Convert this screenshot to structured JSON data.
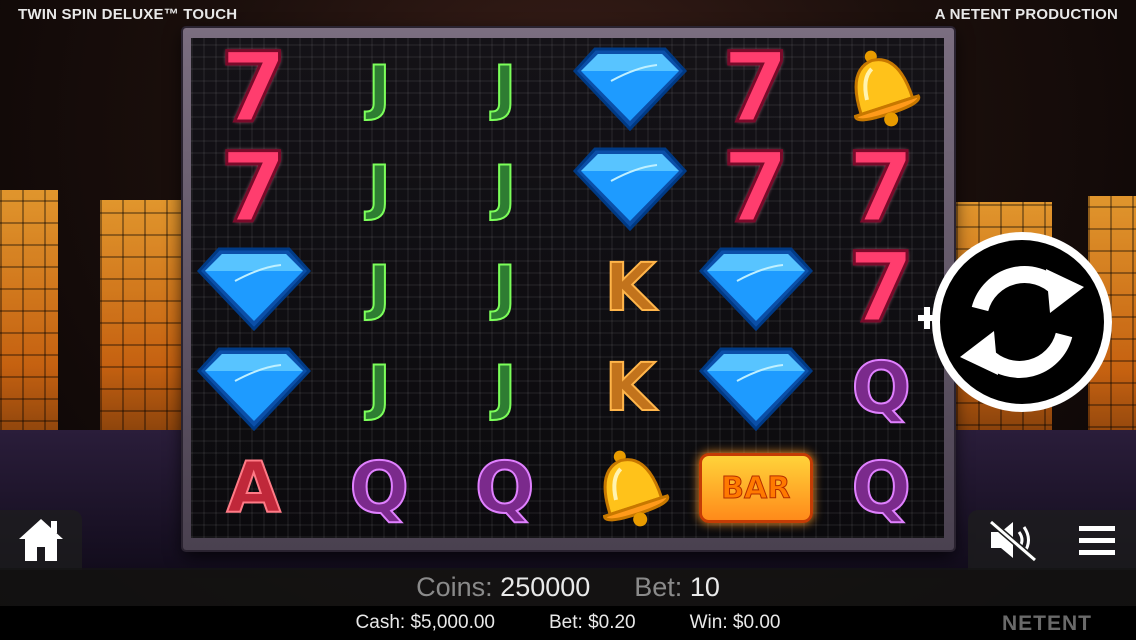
{
  "header": {
    "game_title": "TWIN SPIN DELUXE™ TOUCH",
    "producer": "A NETENT PRODUCTION"
  },
  "reels": [
    [
      "seven",
      "j",
      "j",
      "diamond",
      "seven",
      "bell"
    ],
    [
      "seven",
      "j",
      "j",
      "diamond",
      "seven",
      "seven"
    ],
    [
      "diamond",
      "j",
      "j",
      "k",
      "diamond",
      "seven"
    ],
    [
      "diamond",
      "j",
      "j",
      "k",
      "diamond",
      "q"
    ],
    [
      "a",
      "q",
      "q",
      "bell",
      "bar",
      "q"
    ]
  ],
  "symbol_text": {
    "j": "J",
    "k": "K",
    "q": "Q",
    "a": "A",
    "seven": "7",
    "bar": "BAR"
  },
  "icons": {
    "home": "home-icon",
    "sound": "sound-muted-icon",
    "menu": "menu-icon",
    "spin": "spin-refresh-icon",
    "plus": "plus-icon"
  },
  "info": {
    "coins_label": "Coins:",
    "coins_value": "250000",
    "bet_label": "Bet:",
    "bet_value": "10"
  },
  "status": {
    "cash_label": "Cash:",
    "cash_value": "$5,000.00",
    "bet_label": "Bet:",
    "bet_value": "$0.20",
    "win_label": "Win:",
    "win_value": "$0.00"
  },
  "brand": "NETENT",
  "colors": {
    "seven": "#ff3d6e",
    "diamond": "#1e9bff",
    "bell": "#ffc21a",
    "j": "#2e7d32",
    "k": "#c2731c",
    "q": "#7b2a8c",
    "a": "#c0283a"
  }
}
